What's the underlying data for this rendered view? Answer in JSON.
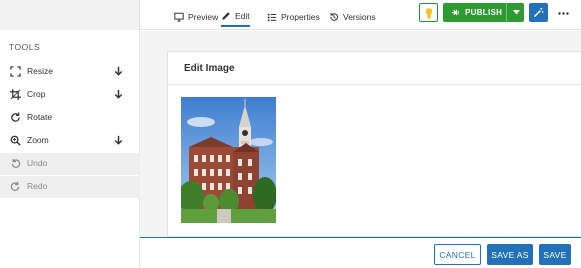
{
  "sidebar": {
    "title": "TOOLS",
    "tools": [
      {
        "label": "Resize",
        "icon": "resize-icon",
        "has_arrow": true,
        "disabled": false
      },
      {
        "label": "Crop",
        "icon": "crop-icon",
        "has_arrow": true,
        "disabled": false
      },
      {
        "label": "Rotate",
        "icon": "rotate-icon",
        "has_arrow": false,
        "disabled": false
      },
      {
        "label": "Zoom",
        "icon": "zoom-icon",
        "has_arrow": true,
        "disabled": false
      },
      {
        "label": "Undo",
        "icon": "undo-icon",
        "has_arrow": false,
        "disabled": true
      },
      {
        "label": "Redo",
        "icon": "redo-icon",
        "has_arrow": false,
        "disabled": true
      }
    ]
  },
  "header": {
    "tabs": [
      {
        "label": "Preview",
        "icon": "monitor-icon",
        "active": false
      },
      {
        "label": "Edit",
        "icon": "pencil-icon",
        "active": true
      },
      {
        "label": "Properties",
        "icon": "list-icon",
        "active": false
      },
      {
        "label": "Versions",
        "icon": "history-icon",
        "active": false
      }
    ],
    "publish_label": "PUBLISH",
    "lightbulb_icon": "lightbulb-icon",
    "wand_icon": "magic-wand-icon",
    "more_icon": "more-dots-icon"
  },
  "panel": {
    "title": "Edit Image",
    "image_alt": "Brick building with clock tower"
  },
  "footer": {
    "cancel_label": "CANCEL",
    "save_as_label": "SAVE AS",
    "save_label": "SAVE"
  },
  "colors": {
    "accent": "#2372b9",
    "publish_green": "#2e9a32",
    "sidebar_disabled_bg": "#efefef",
    "main_bg": "#f4f4f4"
  }
}
